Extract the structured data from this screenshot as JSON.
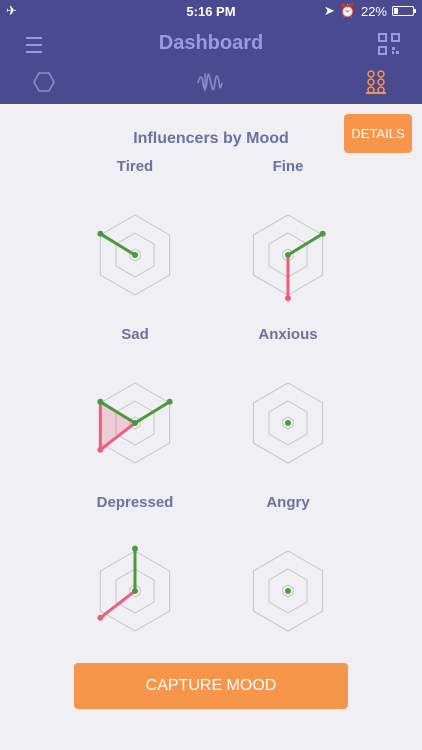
{
  "status_bar": {
    "time": "5:16 PM",
    "battery": "22%"
  },
  "header": {
    "title": "Dashboard"
  },
  "tabs": [
    {
      "name": "overview",
      "icon": "hexagon-icon"
    },
    {
      "name": "trends",
      "icon": "waveform-icon"
    },
    {
      "name": "influencers",
      "icon": "circles-grid-icon",
      "active": true
    }
  ],
  "section": {
    "title": "Influencers by Mood",
    "details_label": "DETAILS"
  },
  "moods": [
    {
      "label": "Tired",
      "green_pts": [
        [
          -1,
          -0.53
        ]
      ],
      "red_pts": []
    },
    {
      "label": "Fine",
      "green_pts": [
        [
          1,
          -0.53
        ]
      ],
      "red_pts": [
        [
          0,
          1.08
        ]
      ]
    },
    {
      "label": "Sad",
      "green_pts": [
        [
          -1,
          -0.53
        ],
        [
          1,
          -0.53
        ]
      ],
      "red_pts": [
        [
          -1,
          -0.53
        ],
        [
          -1,
          0.67
        ]
      ]
    },
    {
      "label": "Anxious",
      "green_pts": [],
      "red_pts": []
    },
    {
      "label": "Depressed",
      "green_pts": [
        [
          0,
          -1.06
        ]
      ],
      "red_pts": [
        [
          -1,
          0.67
        ]
      ]
    },
    {
      "label": "Angry",
      "green_pts": [],
      "red_pts": []
    }
  ],
  "capture": {
    "label": "CAPTURE MOOD"
  },
  "colors": {
    "header": "#4a4a90",
    "accent": "#f7954a",
    "title": "#9a9ae0",
    "green": "#4a9a3a",
    "red": "#ee5e7a"
  }
}
